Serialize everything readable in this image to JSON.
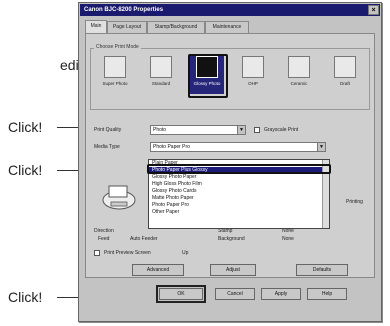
{
  "annotations": {
    "cropped_word": "edia",
    "click_label": "Click!"
  },
  "window": {
    "title": "Canon BJC-8200 Properties",
    "close_glyph": "×"
  },
  "tabs": [
    "Main",
    "Page Layout",
    "Stamp/Background",
    "Maintenance"
  ],
  "print_mode": {
    "group_label": "Choose Print Mode",
    "modes": [
      "Super Photo",
      "Standard",
      "Glossy Photo",
      "OHP",
      "Ceramic",
      "Draft"
    ],
    "selected": "Glossy Photo"
  },
  "quality": {
    "label": "Print Quality",
    "value": "Photo",
    "checkbox_label": "Grayscale Print"
  },
  "media": {
    "label": "Media Type",
    "value": "Photo Paper Pro"
  },
  "dropdown": {
    "options": [
      "Plain Paper",
      "Photo Paper Plus Glossy",
      "Glossy Photo Paper",
      "High Gloss Photo Film",
      "Glossy Photo Cards",
      "Matte Photo Paper",
      "Photo Paper Pro",
      "Other Paper"
    ],
    "selected": "Photo Paper Plus Glossy"
  },
  "info": {
    "printing": "Printing",
    "direction_label": "Direction",
    "feed_label": "Feed",
    "auto_feeder": "Auto Feeder",
    "stamp": "Stamp",
    "background": "Background",
    "none1": "None",
    "none2": "None"
  },
  "options": {
    "print_preview": "Print Preview Screen",
    "up": "Up"
  },
  "buttons": {
    "advanced": "Advanced",
    "adjust": "Adjust",
    "defaults": "Defaults",
    "ok": "OK",
    "cancel": "Cancel",
    "apply": "Apply",
    "help": "Help"
  }
}
